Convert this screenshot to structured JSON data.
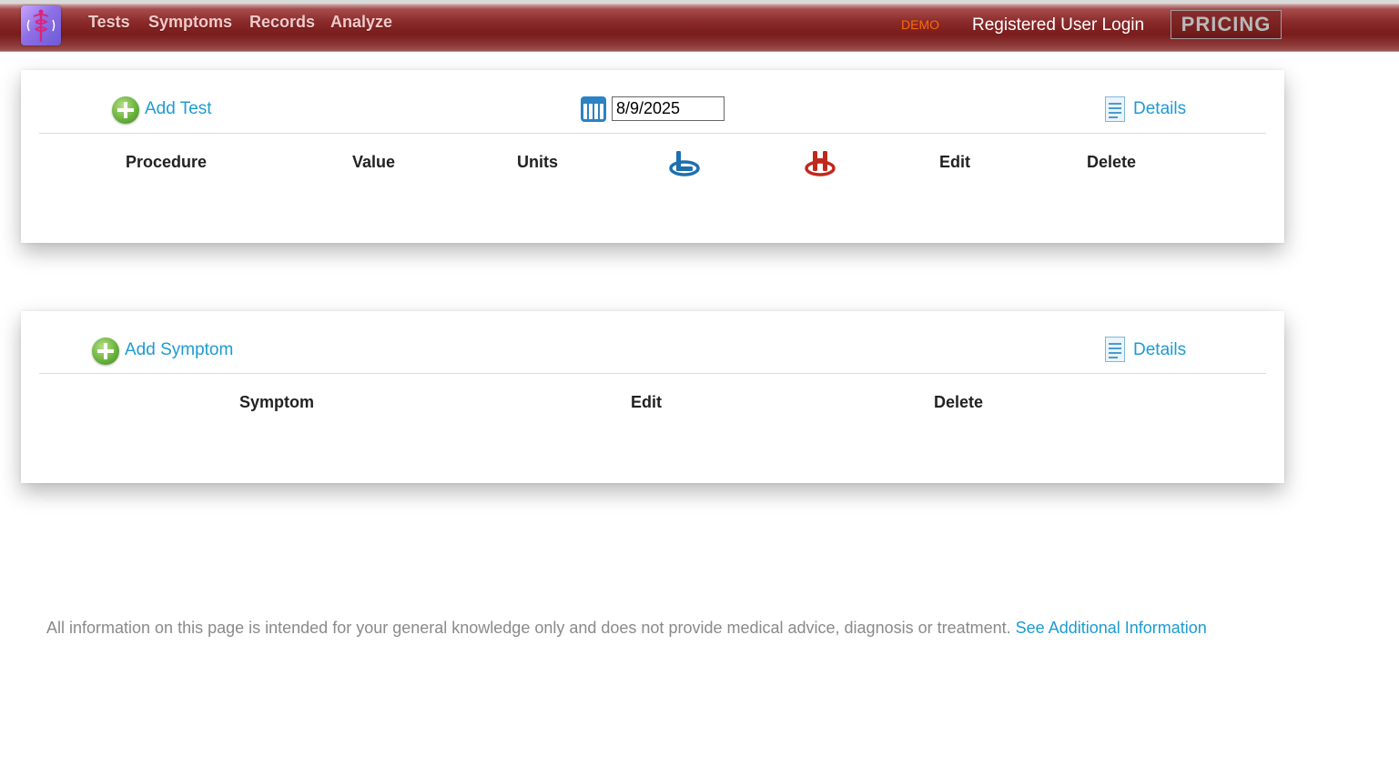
{
  "nav": {
    "links": [
      "Tests",
      "Symptoms",
      "Records",
      "Analyze"
    ],
    "demo": "DEMO",
    "login": "Registered User Login",
    "pricing": "PRICING"
  },
  "tests_panel": {
    "add_label": "Add Test",
    "date_value": "8/9/2025",
    "details_label": "Details",
    "columns": [
      "Procedure",
      "Value",
      "Units",
      "Edit",
      "Delete"
    ],
    "icon_columns": [
      "low-icon",
      "high-icon"
    ]
  },
  "symptoms_panel": {
    "add_label": "Add Symptom",
    "details_label": "Details",
    "columns": [
      "Symptom",
      "Edit",
      "Delete"
    ]
  },
  "footer": {
    "note": "All information on this page is intended for your general knowledge only and does not provide medical advice, diagnosis or treatment.",
    "link": "See Additional Information"
  },
  "colors": {
    "nav_red": "#7a1c1c",
    "link_blue": "#1d9bd1",
    "demo_orange": "#ff6a00",
    "low_icon": "#1e6fae",
    "high_icon": "#c0281c"
  }
}
